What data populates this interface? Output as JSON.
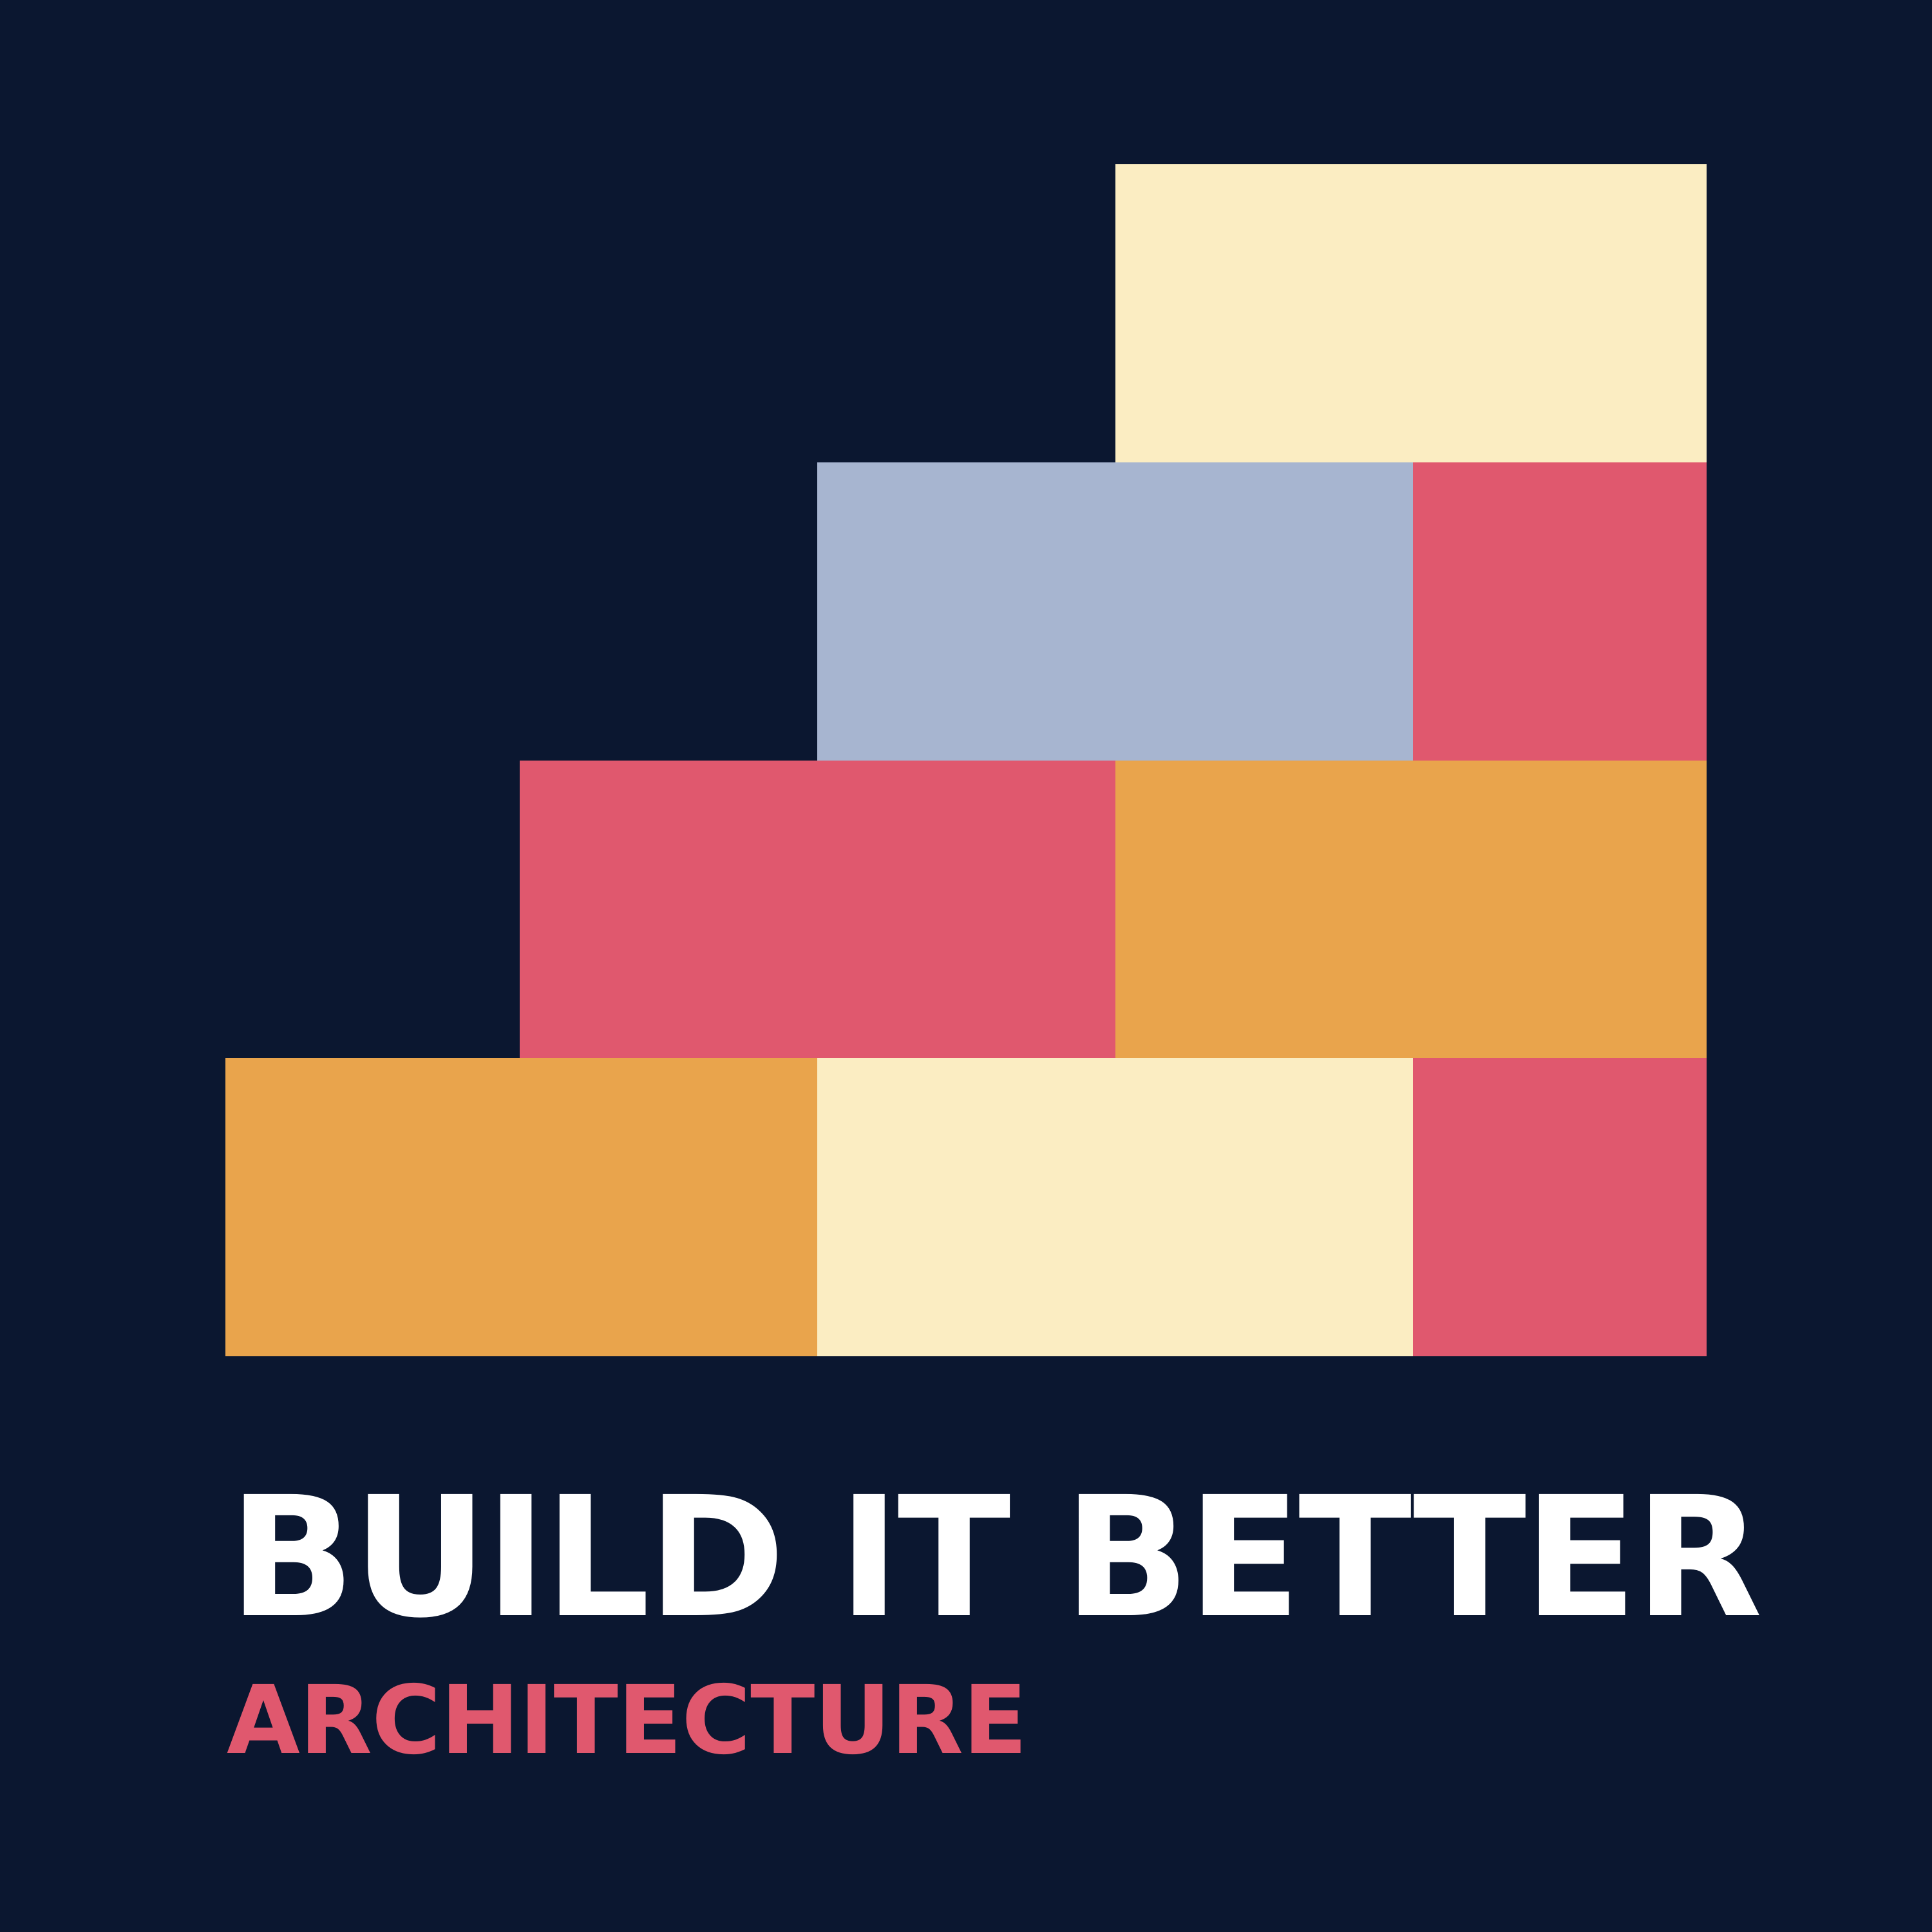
{
  "logo": {
    "title": "BUILD IT BETTER",
    "subtitle": "ARCHITECTURE"
  },
  "colors": {
    "background": "#0b1730",
    "cream": "#fbedc2",
    "lavender": "#a7b5d0",
    "red": "#e0586e",
    "orange": "#e9a44c",
    "title_text": "#ffffff",
    "subtitle_text": "#e0586e"
  },
  "bricks": [
    {
      "id": "b1",
      "color": "#fbedc2"
    },
    {
      "id": "b2",
      "color": "#a7b5d0"
    },
    {
      "id": "b3",
      "color": "#e0586e"
    },
    {
      "id": "b4",
      "color": "#e0586e"
    },
    {
      "id": "b5",
      "color": "#e9a44c"
    },
    {
      "id": "b6",
      "color": "#e9a44c"
    },
    {
      "id": "b7",
      "color": "#fbedc2"
    },
    {
      "id": "b8",
      "color": "#e0586e"
    }
  ]
}
